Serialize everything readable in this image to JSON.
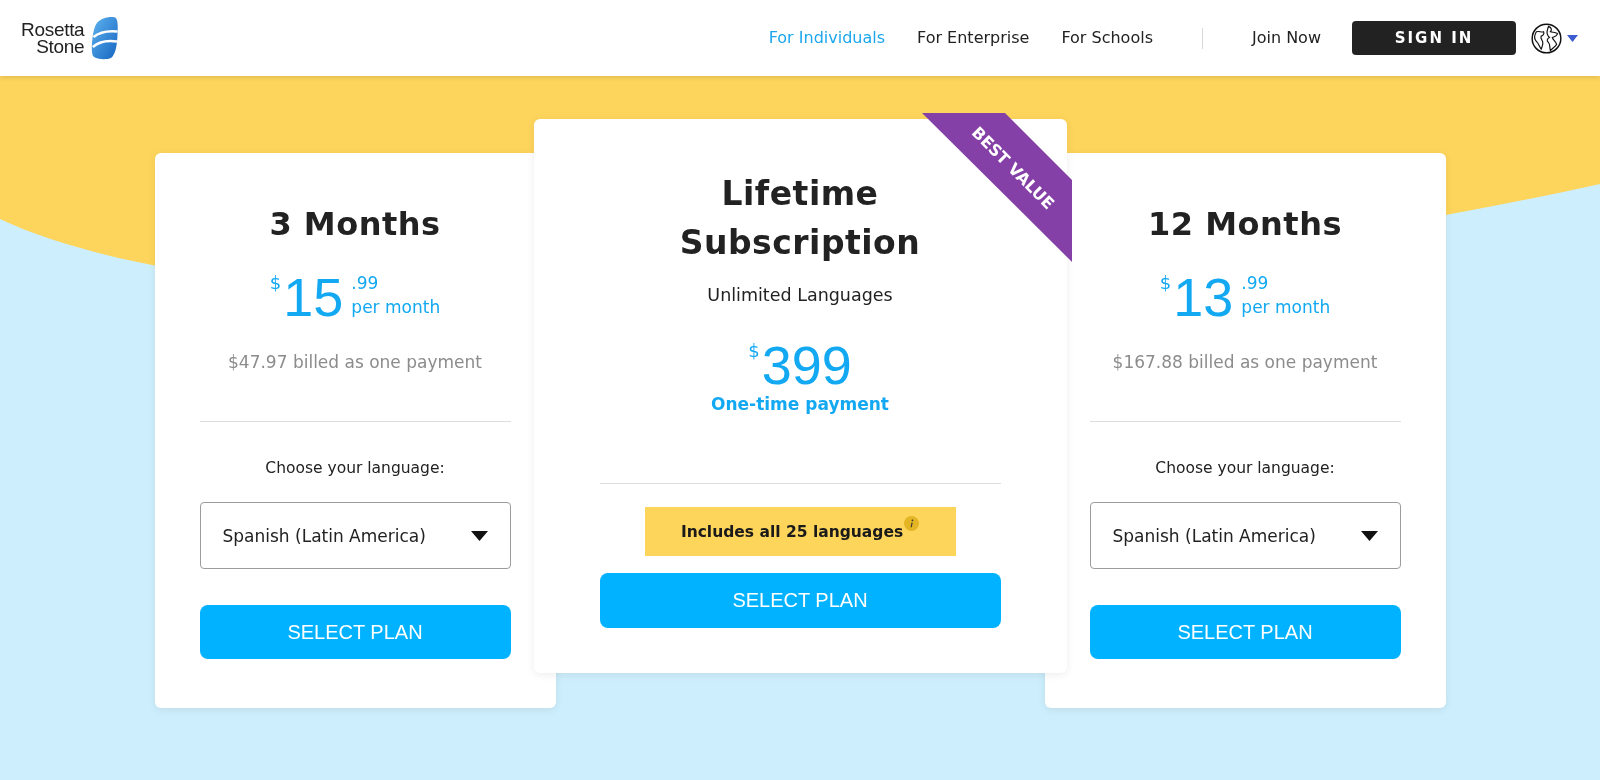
{
  "header": {
    "logo": {
      "lines": [
        "Rosetta",
        "Stone"
      ]
    },
    "nav": [
      {
        "label": "For Individuals",
        "selected": true
      },
      {
        "label": "For Enterprise",
        "selected": false
      },
      {
        "label": "For Schools",
        "selected": false
      }
    ],
    "join_link": "Join Now",
    "sign_in_button": "SIGN IN"
  },
  "plans": [
    {
      "kind": "subscription",
      "title": "3 Months",
      "price": {
        "currency": "$",
        "amount": "15",
        "cents": ".99",
        "period": "per month"
      },
      "billing_note": "$47.97 billed as one payment",
      "language_label": "Choose your language:",
      "language_select": {
        "value": "Spanish (Latin America)"
      },
      "button": "SELECT PLAN"
    },
    {
      "kind": "lifetime",
      "ribbon": "BEST VALUE",
      "title": "Lifetime Subscription",
      "subtitle": "Unlimited Languages",
      "price": {
        "currency": "$",
        "amount": "399"
      },
      "price_note": "One-time payment",
      "highlight": "Includes all 25 languages",
      "button": "SELECT PLAN"
    },
    {
      "kind": "subscription",
      "title": "12 Months",
      "price": {
        "currency": "$",
        "amount": "13",
        "cents": ".99",
        "period": "per month"
      },
      "billing_note": "$167.88 billed as one payment",
      "language_label": "Choose your language:",
      "language_select": {
        "value": "Spanish (Latin America)"
      },
      "button": "SELECT PLAN"
    }
  ]
}
